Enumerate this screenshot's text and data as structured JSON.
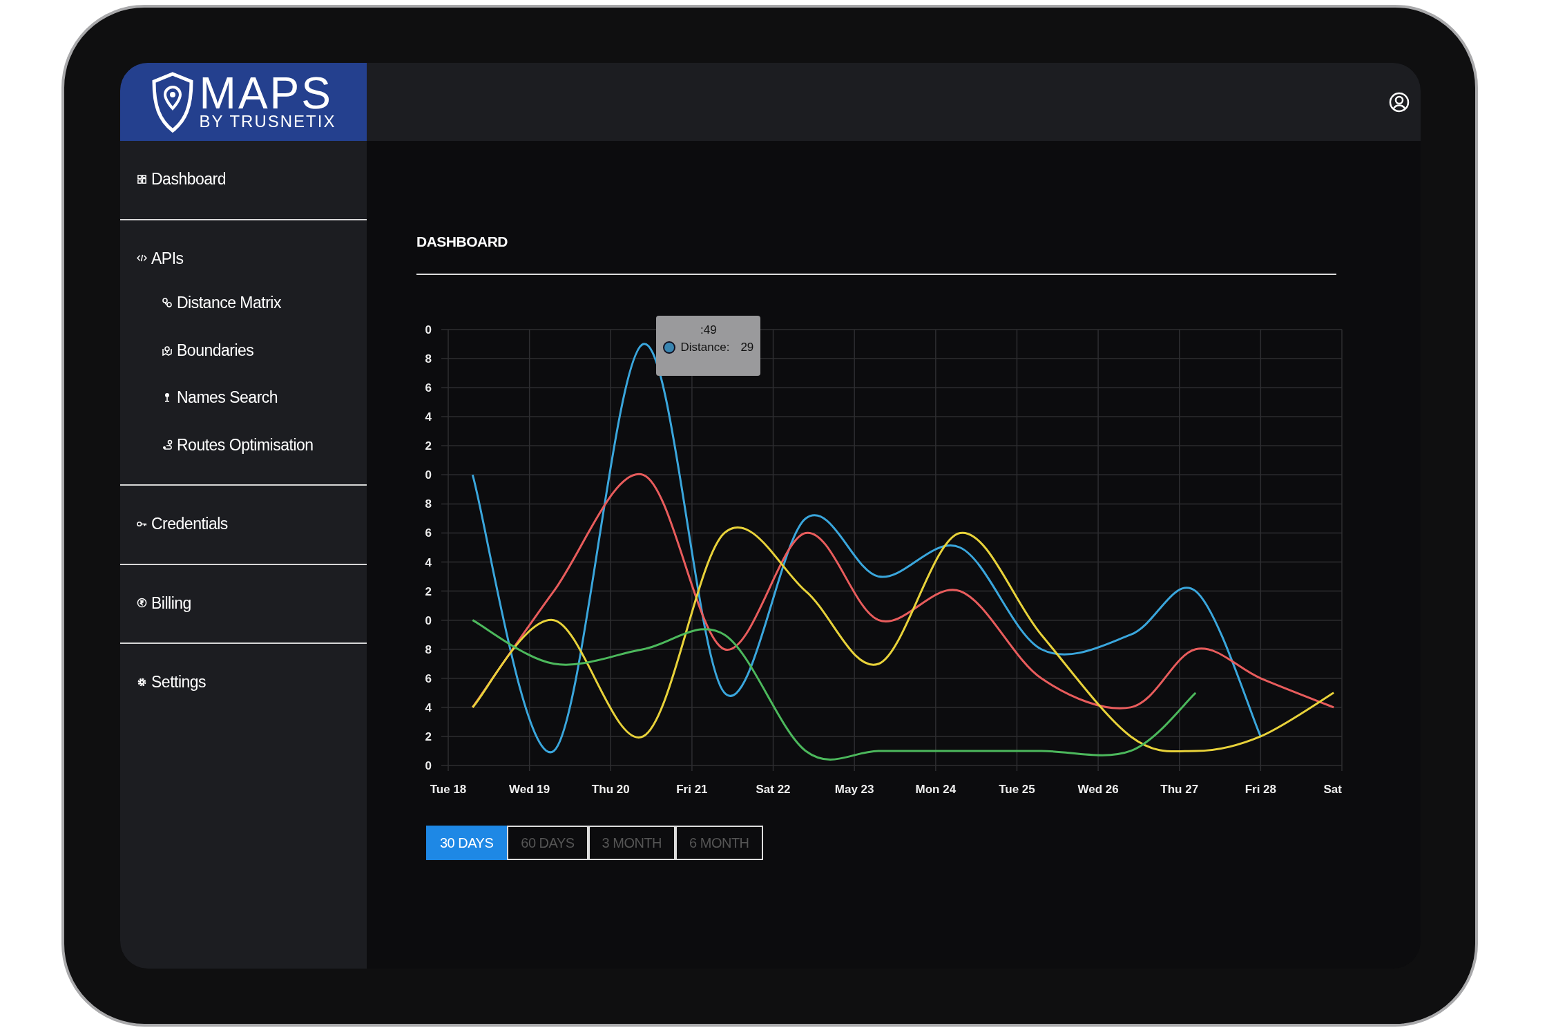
{
  "brand": {
    "name": "MAPS",
    "tagline": "BY TRUSNETIX"
  },
  "sidebar": {
    "sections": [
      {
        "items": [
          {
            "label": "Dashboard"
          }
        ]
      },
      {
        "items": [
          {
            "label": "APIs",
            "children": [
              {
                "label": "Distance Matrix"
              },
              {
                "label": "Boundaries"
              },
              {
                "label": "Names Search"
              },
              {
                "label": "Routes Optimisation"
              }
            ]
          }
        ]
      },
      {
        "items": [
          {
            "label": "Credentials"
          }
        ]
      },
      {
        "items": [
          {
            "label": "Billing"
          }
        ]
      },
      {
        "items": [
          {
            "label": "Settings"
          }
        ]
      }
    ]
  },
  "page": {
    "title": "DASHBOARD"
  },
  "chart": {
    "y_labels": [
      "0",
      "8",
      "6",
      "4",
      "2",
      "0",
      "8",
      "6",
      "4",
      "2",
      "0",
      "8",
      "6",
      "4",
      "2",
      "0"
    ],
    "x_labels": [
      "Tue 18",
      "Wed 19",
      "Thu 20",
      "Fri 21",
      "Sat 22",
      "May 23",
      "Mon 24",
      "Tue 25",
      "Wed 26",
      "Thu 27",
      "Fri 28",
      "Sat"
    ],
    "lines": [
      {
        "color": "#3aa6dc"
      },
      {
        "color": "#e85c5c"
      },
      {
        "color": "#e8d23a"
      },
      {
        "color": "#4cb85c"
      }
    ],
    "tooltip": {
      "title": ":49",
      "label": "Distance:",
      "value": "29",
      "color": "#3a85b0"
    }
  },
  "ranges": [
    {
      "label": "30 DAYS",
      "selected": true
    },
    {
      "label": "60 DAYS",
      "selected": false
    },
    {
      "label": "3 MONTH",
      "selected": false
    },
    {
      "label": "6 MONTH",
      "selected": false
    }
  ]
}
